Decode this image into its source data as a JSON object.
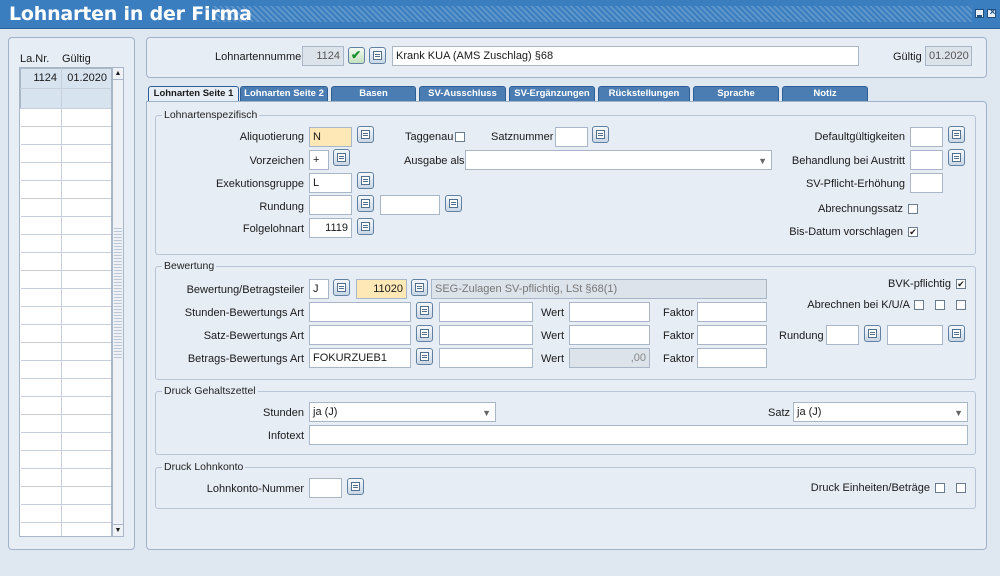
{
  "window": {
    "title": "Lohnarten in der Firma"
  },
  "list": {
    "headers": [
      "La.Nr.",
      "Gültig"
    ],
    "rows": [
      {
        "nr": "1124",
        "gueltig": "01.2020"
      }
    ]
  },
  "header": {
    "lohnartennummer_label": "Lohnartennummer",
    "lohnartennummer_value": "1124",
    "bezeichnung": "Krank KUA (AMS Zuschlag) §68",
    "gueltig_label": "Gültig",
    "gueltig_value": "01.2020"
  },
  "tabs": [
    "Lohnarten Seite 1",
    "Lohnarten Seite 2",
    "Basen",
    "SV-Ausschluss",
    "SV-Ergänzungen",
    "Rückstellungen",
    "Sprache",
    "Notiz"
  ],
  "lohnartenspezifisch": {
    "title": "Lohnartenspezifisch",
    "aliquotierung_label": "Aliquotierung",
    "aliquotierung_value": "N",
    "vorzeichen_label": "Vorzeichen",
    "vorzeichen_value": "+",
    "exekutionsgruppe_label": "Exekutionsgruppe",
    "exekutionsgruppe_value": "L",
    "rundung_label": "Rundung",
    "rundung_value": "",
    "rundung_value2": "",
    "folgelohnart_label": "Folgelohnart",
    "folgelohnart_value": "1119",
    "taggenau_label": "Taggenau",
    "satznummer_label": "Satznummer",
    "satznummer_value": "",
    "ausgabe_als_label": "Ausgabe als",
    "ausgabe_als_value": "",
    "defaultgueltigkeiten_label": "Defaultgültigkeiten",
    "defaultgueltigkeiten_value": "",
    "behandlung_label": "Behandlung bei Austritt",
    "behandlung_value": "",
    "sv_pflicht_label": "SV-Pflicht-Erhöhung",
    "sv_pflicht_value": "",
    "abrechnungssatz_label": "Abrechnungssatz",
    "bis_datum_label": "Bis-Datum vorschlagen",
    "bis_datum_checked": "✔"
  },
  "bewertung": {
    "title": "Bewertung",
    "betragsteiler_label": "Bewertung/Betragsteiler",
    "betragsteiler_value": "J",
    "betragsteiler_code": "11020",
    "betragsteiler_desc": "SEG-Zulagen SV-pflichtig, LSt §68(1)",
    "bvk_label": "BVK-pflichtig",
    "bvk_checked": "✔",
    "abrechnen_label": "Abrechnen bei K/U/A",
    "stunden_label": "Stunden-Bewertungs Art",
    "satz_label": "Satz-Bewertungs Art",
    "betrags_label": "Betrags-Bewertungs Art",
    "betrags_value": "FOKURZUEB1",
    "wert_label": "Wert",
    "faktor_label": "Faktor",
    "betrags_wert": ",00",
    "rundung_label": "Rundung"
  },
  "druck_gehaltszettel": {
    "title": "Druck Gehaltszettel",
    "stunden_label": "Stunden",
    "stunden_value": "ja (J)",
    "satz_label": "Satz",
    "satz_value": "ja (J)",
    "infotext_label": "Infotext",
    "infotext_value": ""
  },
  "druck_lohnkonto": {
    "title": "Druck Lohnkonto",
    "nummer_label": "Lohnkonto-Nummer",
    "nummer_value": "",
    "einheiten_label": "Druck Einheiten/Beträge"
  },
  "colors": {
    "titlebar": "#3a7ec0",
    "tab": "#4b7db3",
    "highlight": "#fde8b6",
    "panel": "#e7edf5"
  }
}
